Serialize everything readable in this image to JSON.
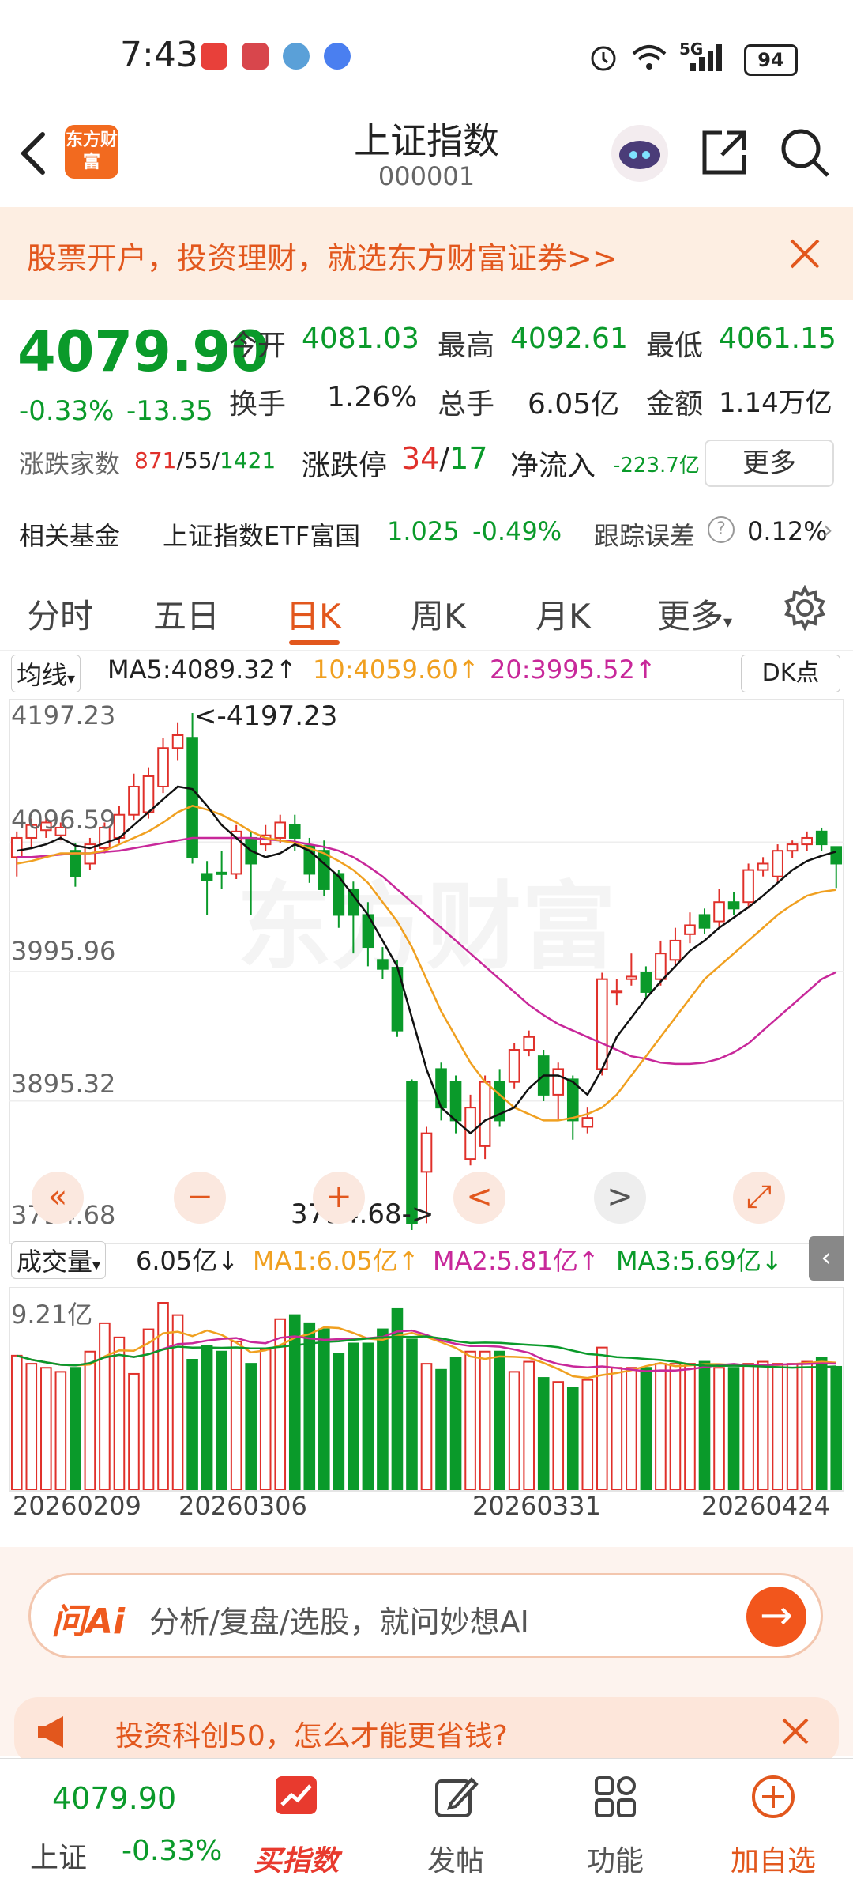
{
  "status_bar": {
    "time": "7:43",
    "network": "5G",
    "battery": "94"
  },
  "header": {
    "logo_text": "东方财富",
    "title": "上证指数",
    "code": "000001"
  },
  "banner": {
    "text": "股票开户，投资理财，就选东方财富证券>>"
  },
  "quote": {
    "price": "4079.90",
    "change_pct": "-0.33%",
    "change": "-13.35",
    "open_label": "今开",
    "open": "4081.03",
    "high_label": "最高",
    "high": "4092.61",
    "low_label": "最低",
    "low": "4061.15",
    "turnover_label": "换手",
    "turnover": "1.26%",
    "volume_label": "总手",
    "volume": "6.05亿",
    "amount_label": "金额",
    "amount": "1.14万亿",
    "breadth_label": "涨跌家数",
    "breadth_up": "871",
    "breadth_flat": "55",
    "breadth_down": "1421",
    "limit_label": "涨跌停",
    "limit_up": "34",
    "limit_down": "17",
    "netflow_label": "净流入",
    "netflow": "-223.7亿",
    "more_label": "更多"
  },
  "funds": {
    "label": "相关基金",
    "name": "上证指数ETF富国",
    "price": "1.025",
    "change": "-0.49%",
    "error_label": "跟踪误差",
    "error": "0.12%"
  },
  "tabs": [
    "分时",
    "五日",
    "日K",
    "周K",
    "月K",
    "更多"
  ],
  "chart": {
    "ma_selector": "均线",
    "ma5": "MA5:4089.32↑",
    "ma10": "10:4059.60↑",
    "ma20": "20:3995.52↑",
    "dk_label": "DK点",
    "y_labels": [
      "4197.23",
      "4096.59",
      "3995.96",
      "3895.32",
      "3794.68"
    ],
    "high_marker": "<-4197.23",
    "low_marker": "3794.68->",
    "vol_selector": "成交量",
    "vol_value": "6.05亿↓",
    "vol_ma1": "MA1:6.05亿↑",
    "vol_ma2": "MA2:5.81亿↑",
    "vol_ma3": "MA3:5.69亿↓",
    "vol_max": "9.21亿",
    "dates": [
      "20260209",
      "20260306",
      "20260331",
      "20260424"
    ],
    "colors": {
      "up": "#e0302a",
      "down": "#0a9a2a",
      "ma5": "#111111",
      "ma10": "#f0a020",
      "ma20": "#c8289a"
    }
  },
  "chart_data": {
    "type": "candlestick",
    "title": "",
    "ylim": [
      3794.68,
      4197.23
    ],
    "candles": [
      {
        "o": 4085,
        "c": 4100,
        "h": 4105,
        "l": 4070
      },
      {
        "o": 4100,
        "c": 4110,
        "h": 4115,
        "l": 4092
      },
      {
        "o": 4106,
        "c": 4112,
        "h": 4118,
        "l": 4100
      },
      {
        "o": 4102,
        "c": 4108,
        "h": 4112,
        "l": 4098
      },
      {
        "o": 4090,
        "c": 4070,
        "h": 4096,
        "l": 4062
      },
      {
        "o": 4080,
        "c": 4095,
        "h": 4100,
        "l": 4075
      },
      {
        "o": 4092,
        "c": 4108,
        "h": 4112,
        "l": 4088
      },
      {
        "o": 4100,
        "c": 4118,
        "h": 4125,
        "l": 4095
      },
      {
        "o": 4118,
        "c": 4140,
        "h": 4150,
        "l": 4114
      },
      {
        "o": 4120,
        "c": 4148,
        "h": 4155,
        "l": 4115
      },
      {
        "o": 4140,
        "c": 4170,
        "h": 4178,
        "l": 4135
      },
      {
        "o": 4170,
        "c": 4180,
        "h": 4190,
        "l": 4160
      },
      {
        "o": 4178,
        "c": 4085,
        "h": 4197.23,
        "l": 4080
      },
      {
        "o": 4072,
        "c": 4067,
        "h": 4082,
        "l": 4040
      },
      {
        "o": 4073,
        "c": 4072,
        "h": 4090,
        "l": 4060
      },
      {
        "o": 4072,
        "c": 4105,
        "h": 4110,
        "l": 4068
      },
      {
        "o": 4100,
        "c": 4080,
        "h": 4105,
        "l": 4040
      },
      {
        "o": 4095,
        "c": 4102,
        "h": 4110,
        "l": 4090
      },
      {
        "o": 4100,
        "c": 4112,
        "h": 4118,
        "l": 4096
      },
      {
        "o": 4110,
        "c": 4100,
        "h": 4118,
        "l": 4090
      },
      {
        "o": 4094,
        "c": 4072,
        "h": 4100,
        "l": 4065
      },
      {
        "o": 4090,
        "c": 4060,
        "h": 4098,
        "l": 4055
      },
      {
        "o": 4072,
        "c": 4040,
        "h": 4075,
        "l": 4030
      },
      {
        "o": 4060,
        "c": 4040,
        "h": 4066,
        "l": 4010
      },
      {
        "o": 4040,
        "c": 4015,
        "h": 4050,
        "l": 4000
      },
      {
        "o": 4005,
        "c": 3998,
        "h": 4015,
        "l": 3990
      },
      {
        "o": 3999,
        "c": 3950,
        "h": 4005,
        "l": 3945
      },
      {
        "o": 3910,
        "c": 3800,
        "h": 3912,
        "l": 3794.68
      },
      {
        "o": 3840,
        "c": 3870,
        "h": 3875,
        "l": 3800
      },
      {
        "o": 3920,
        "c": 3890,
        "h": 3925,
        "l": 3880
      },
      {
        "o": 3910,
        "c": 3880,
        "h": 3915,
        "l": 3870
      },
      {
        "o": 3850,
        "c": 3890,
        "h": 3900,
        "l": 3845
      },
      {
        "o": 3860,
        "c": 3910,
        "h": 3915,
        "l": 3850
      },
      {
        "o": 3910,
        "c": 3880,
        "h": 3920,
        "l": 3875
      },
      {
        "o": 3910,
        "c": 3935,
        "h": 3940,
        "l": 3905
      },
      {
        "o": 3935,
        "c": 3945,
        "h": 3950,
        "l": 3930
      },
      {
        "o": 3930,
        "c": 3900,
        "h": 3935,
        "l": 3895
      },
      {
        "o": 3900,
        "c": 3920,
        "h": 3925,
        "l": 3880
      },
      {
        "o": 3912,
        "c": 3880,
        "h": 3915,
        "l": 3865
      },
      {
        "o": 3875,
        "c": 3882,
        "h": 3890,
        "l": 3870
      },
      {
        "o": 3920,
        "c": 3990,
        "h": 3995,
        "l": 3915
      },
      {
        "o": 3980,
        "c": 3981,
        "h": 3990,
        "l": 3970
      },
      {
        "o": 3990,
        "c": 3992,
        "h": 4010,
        "l": 3985
      },
      {
        "o": 3995,
        "c": 3980,
        "h": 4000,
        "l": 3975
      },
      {
        "o": 3990,
        "c": 4010,
        "h": 4020,
        "l": 3985
      },
      {
        "o": 4005,
        "c": 4020,
        "h": 4030,
        "l": 4000
      },
      {
        "o": 4025,
        "c": 4032,
        "h": 4042,
        "l": 4018
      },
      {
        "o": 4040,
        "c": 4030,
        "h": 4045,
        "l": 4025
      },
      {
        "o": 4035,
        "c": 4050,
        "h": 4060,
        "l": 4030
      },
      {
        "o": 4050,
        "c": 4045,
        "h": 4058,
        "l": 4040
      },
      {
        "o": 4050,
        "c": 4075,
        "h": 4080,
        "l": 4045
      },
      {
        "o": 4075,
        "c": 4080,
        "h": 4085,
        "l": 4070
      },
      {
        "o": 4070,
        "c": 4090,
        "h": 4095,
        "l": 4065
      },
      {
        "o": 4090,
        "c": 4095,
        "h": 4098,
        "l": 4084
      },
      {
        "o": 4095,
        "c": 4100,
        "h": 4105,
        "l": 4090
      },
      {
        "o": 4105,
        "c": 4095,
        "h": 4108,
        "l": 4090
      },
      {
        "o": 4093,
        "c": 4080,
        "h": 4093,
        "l": 4061
      }
    ],
    "ma5": [
      4090,
      4092,
      4095,
      4100,
      4094,
      4092,
      4096,
      4100,
      4110,
      4120,
      4130,
      4140,
      4138,
      4125,
      4110,
      4100,
      4090,
      4085,
      4088,
      4095,
      4090,
      4080,
      4070,
      4055,
      4040,
      4020,
      4000,
      3960,
      3920,
      3890,
      3880,
      3870,
      3880,
      3885,
      3890,
      3905,
      3915,
      3915,
      3910,
      3900,
      3920,
      3945,
      3960,
      3975,
      3988,
      4000,
      4012,
      4020,
      4030,
      4038,
      4046,
      4055,
      4065,
      4075,
      4082,
      4086,
      4089.32
    ],
    "ma10": [
      4080,
      4082,
      4085,
      4088,
      4088,
      4088,
      4090,
      4095,
      4100,
      4105,
      4112,
      4120,
      4125,
      4122,
      4118,
      4112,
      4105,
      4100,
      4098,
      4096,
      4092,
      4088,
      4082,
      4075,
      4065,
      4050,
      4035,
      4015,
      3990,
      3965,
      3945,
      3925,
      3910,
      3900,
      3890,
      3885,
      3880,
      3880,
      3882,
      3885,
      3890,
      3900,
      3915,
      3930,
      3945,
      3960,
      3975,
      3990,
      4000,
      4010,
      4020,
      4030,
      4040,
      4048,
      4055,
      4058,
      4059.6
    ],
    "ma20": [
      4085,
      4085,
      4086,
      4087,
      4088,
      4088,
      4089,
      4090,
      4092,
      4094,
      4096,
      4098,
      4100,
      4100,
      4100,
      4100,
      4100,
      4099,
      4098,
      4097,
      4095,
      4093,
      4090,
      4085,
      4078,
      4070,
      4060,
      4050,
      4040,
      4030,
      4020,
      4010,
      4000,
      3990,
      3980,
      3970,
      3962,
      3955,
      3950,
      3945,
      3940,
      3935,
      3930,
      3928,
      3925,
      3924,
      3924,
      3925,
      3928,
      3933,
      3940,
      3950,
      3960,
      3970,
      3980,
      3990,
      3995.52
    ],
    "volumes": [
      6.6,
      6.2,
      6.0,
      5.8,
      6.0,
      6.8,
      8.2,
      7.5,
      5.7,
      7.9,
      9.21,
      8.6,
      6.4,
      7.1,
      6.8,
      7.3,
      6.2,
      6.9,
      8.4,
      8.6,
      8.2,
      7.9,
      6.7,
      7.2,
      7.2,
      7.9,
      8.9,
      7.4,
      6.2,
      5.9,
      6.5,
      6.8,
      6.8,
      6.8,
      5.8,
      6.3,
      5.5,
      5.3,
      5.0,
      5.4,
      7.0,
      6.0,
      6.0,
      6.0,
      6.2,
      6.2,
      6.2,
      6.3,
      6.0,
      6.0,
      6.2,
      6.3,
      6.2,
      6.2,
      6.3,
      6.5,
      6.05
    ],
    "vol_ylim": [
      0,
      9.21
    ]
  },
  "chart_controls": {
    "rewind": "«",
    "zoom_out": "−",
    "zoom_in": "+",
    "prev": "<",
    "next": ">",
    "fullscreen": "⤢"
  },
  "ai": {
    "logo": "问Ai",
    "placeholder": "分析/复盘/选股，就问妙想AI",
    "go": "→"
  },
  "promo": {
    "text": "投资科创50，怎么才能更省钱?"
  },
  "bottom_nav": {
    "index_price": "4079.90",
    "index_name": "上证",
    "index_change": "-0.33%",
    "items": [
      "买指数",
      "发帖",
      "功能",
      "加自选"
    ]
  }
}
